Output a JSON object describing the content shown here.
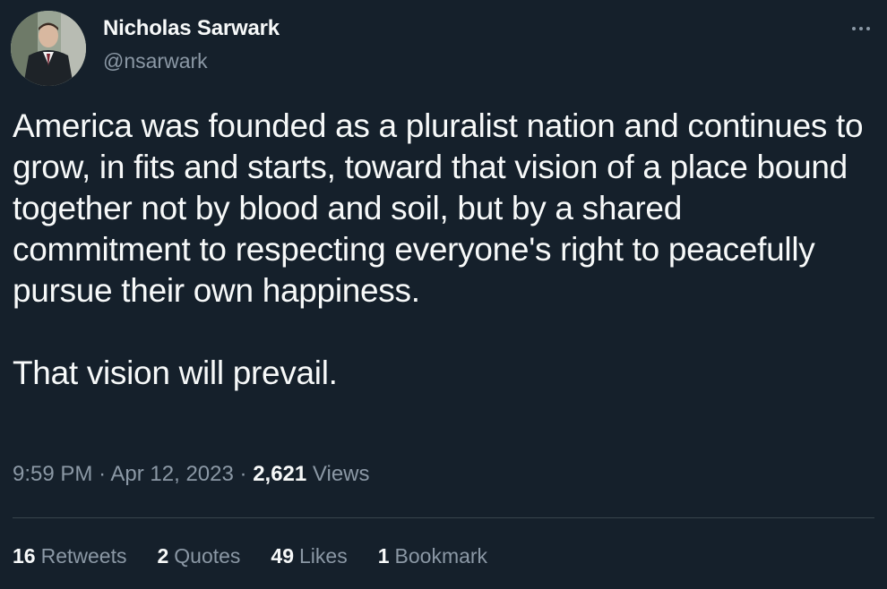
{
  "author": {
    "name": "Nicholas Sarwark",
    "handle": "@nsarwark"
  },
  "tweet": {
    "paragraphs": [
      "America was founded as a pluralist nation and continues to grow, in fits and starts, toward that vision of a place bound together not by blood and soil, but by a shared commitment to respecting everyone's right to peacefully pursue their own happiness.",
      "That vision will prevail."
    ]
  },
  "meta": {
    "time": "9:59 PM",
    "separator": "·",
    "date": "Apr 12, 2023",
    "views_count": "2,621",
    "views_label": "Views"
  },
  "stats": {
    "retweets_count": "16",
    "retweets_label": "Retweets",
    "quotes_count": "2",
    "quotes_label": "Quotes",
    "likes_count": "49",
    "likes_label": "Likes",
    "bookmarks_count": "1",
    "bookmarks_label": "Bookmark"
  },
  "icons": {
    "more": "more-horizontal-icon"
  },
  "colors": {
    "background": "#15202b",
    "primary_text": "#f7f9f9",
    "secondary_text": "#8b98a5",
    "divider": "#38444d"
  }
}
